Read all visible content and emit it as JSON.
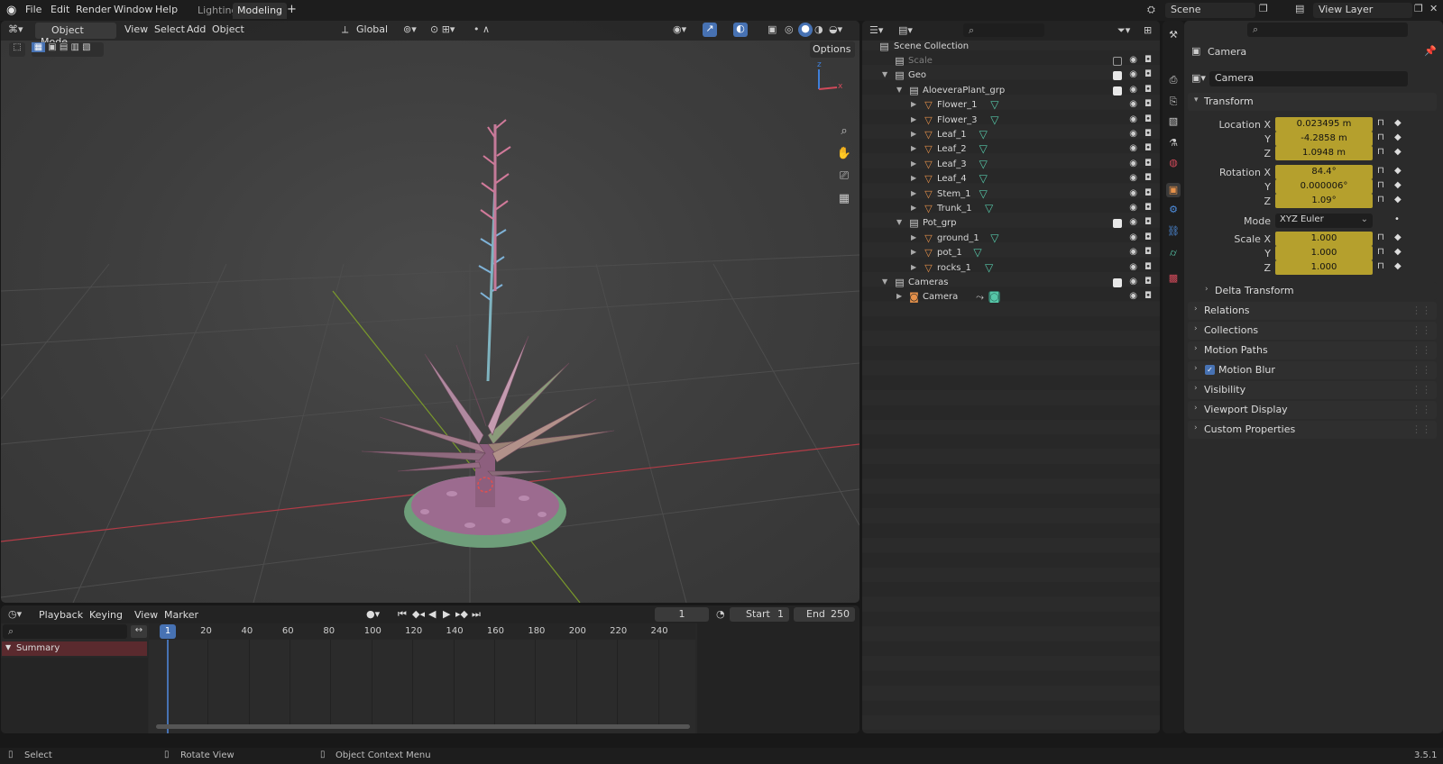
{
  "topbar": {
    "menus": [
      "File",
      "Edit",
      "Render",
      "Window",
      "Help"
    ],
    "workspace_tabs": [
      "Lighting",
      "Modeling"
    ],
    "active_tab": "Modeling",
    "add_tab": "+",
    "scene": "Scene",
    "view_layer": "View Layer"
  },
  "viewport": {
    "mode": "Object Mode",
    "menus": [
      "View",
      "Select",
      "Add",
      "Object"
    ],
    "orientation": "Global",
    "options_label": "Options",
    "gizmo_axes": {
      "z": "z",
      "x": "x"
    }
  },
  "outliner": {
    "root": "Scene Collection",
    "rows": [
      {
        "label": "Scale",
        "type": "collection",
        "level": 0,
        "checked": false,
        "dim": true
      },
      {
        "label": "Geo",
        "type": "collection",
        "level": 0,
        "checked": true
      },
      {
        "label": "AloeveraPlant_grp",
        "type": "collection",
        "level": 1,
        "checked": true
      },
      {
        "label": "Flower_1",
        "type": "mesh",
        "level": 2
      },
      {
        "label": "Flower_3",
        "type": "mesh",
        "level": 2
      },
      {
        "label": "Leaf_1",
        "type": "mesh",
        "level": 2
      },
      {
        "label": "Leaf_2",
        "type": "mesh",
        "level": 2
      },
      {
        "label": "Leaf_3",
        "type": "mesh",
        "level": 2
      },
      {
        "label": "Leaf_4",
        "type": "mesh",
        "level": 2
      },
      {
        "label": "Stem_1",
        "type": "mesh",
        "level": 2
      },
      {
        "label": "Trunk_1",
        "type": "mesh",
        "level": 2
      },
      {
        "label": "Pot_grp",
        "type": "collection",
        "level": 1,
        "checked": true
      },
      {
        "label": "ground_1",
        "type": "mesh",
        "level": 2
      },
      {
        "label": "pot_1",
        "type": "mesh",
        "level": 2
      },
      {
        "label": "rocks_1",
        "type": "mesh",
        "level": 2
      },
      {
        "label": "Cameras",
        "type": "collection",
        "level": 0,
        "checked": true
      },
      {
        "label": "Camera",
        "type": "camera",
        "level": 1
      }
    ]
  },
  "properties": {
    "header_name": "Camera",
    "object_name": "Camera",
    "transform_title": "Transform",
    "location_label": "Location X",
    "location": [
      "0.023495 m",
      "-4.2858 m",
      "1.0948 m"
    ],
    "rotation_label": "Rotation X",
    "rotation": [
      "84.4°",
      "0.000006°",
      "1.09°"
    ],
    "mode_label": "Mode",
    "mode_value": "XYZ Euler",
    "scale_label": "Scale X",
    "scale": [
      "1.000",
      "1.000",
      "1.000"
    ],
    "axis_y": "Y",
    "axis_z": "Z",
    "delta_transform": "Delta Transform",
    "panels": [
      "Relations",
      "Collections",
      "Motion Paths",
      "Motion Blur",
      "Visibility",
      "Viewport Display",
      "Custom Properties"
    ]
  },
  "timeline": {
    "menus": [
      "Playback",
      "Keying",
      "View",
      "Marker"
    ],
    "current_frame": "1",
    "start_label": "Start",
    "start": "1",
    "end_label": "End",
    "end": "250",
    "summary": "Summary",
    "ticks": [
      "1",
      "20",
      "40",
      "60",
      "80",
      "100",
      "120",
      "140",
      "160",
      "180",
      "200",
      "220",
      "240"
    ]
  },
  "statusbar": {
    "select": "Select",
    "rotate": "Rotate View",
    "context": "Object Context Menu",
    "version": "3.5.1"
  },
  "colors": {
    "accent_blue": "#4772b3",
    "field_yellow": "#b5a02d",
    "mesh_orange": "#e6914a",
    "data_green": "#56c7a8",
    "x_axis_red": "#b33c47",
    "y_axis_green": "#7a9a2b"
  }
}
